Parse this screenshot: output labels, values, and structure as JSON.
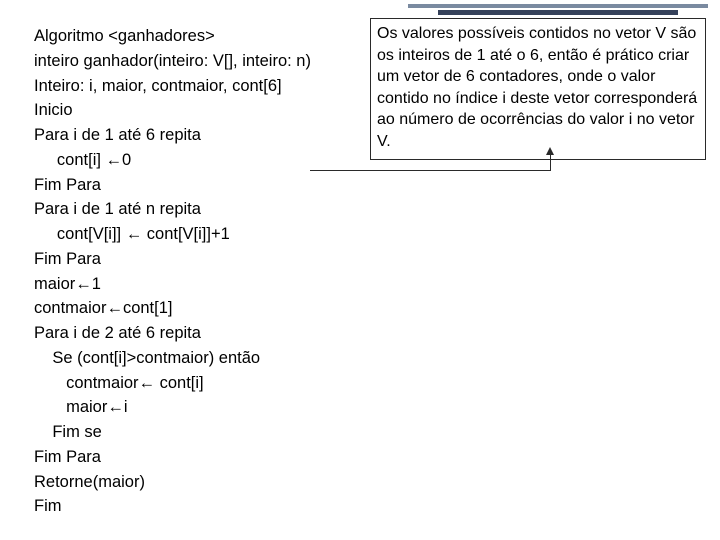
{
  "code": {
    "l0": "Algoritmo <ganhadores>",
    "l1": "",
    "l2": "inteiro ganhador(inteiro: V[], inteiro: n)",
    "l3": "Inteiro: i, maior, contmaior, cont[6]",
    "l4": "Inicio",
    "l5": "Para i de 1 até 6 repita",
    "l6": "     cont[i] ←0",
    "l7": "Fim Para",
    "l8": "Para i de 1 até n repita",
    "l9": "     cont[V[i]] ← cont[V[i]]+1",
    "l10": "Fim Para",
    "l11": "maior←1",
    "l12": "contmaior←cont[1]",
    "l13": "Para i de 2 até 6 repita",
    "l14": "    Se (cont[i]>contmaior) então",
    "l15": "       contmaior← cont[i]",
    "l16": "       maior←i",
    "l17": "    Fim se",
    "l18": "Fim Para",
    "l19": "Retorne(maior)",
    "l20": "Fim"
  },
  "callout": {
    "text": "Os valores possíveis contidos no vetor V são os inteiros de 1 até o 6, então é prático criar um vetor de 6 contadores, onde o valor contido no índice i deste vetor corresponderá ao número de ocorrências do valor i no vetor V."
  }
}
